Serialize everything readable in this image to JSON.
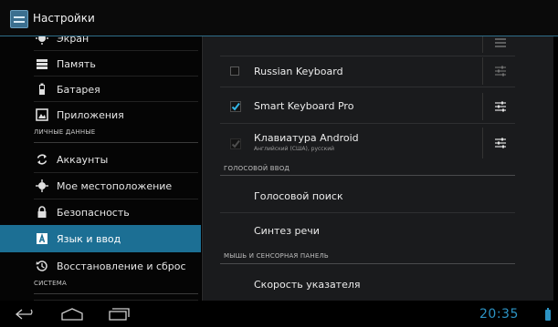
{
  "app": {
    "title": "Настройки"
  },
  "sidebar": {
    "items": [
      {
        "label": "Экран",
        "icon": "display-icon"
      },
      {
        "label": "Память",
        "icon": "storage-icon"
      },
      {
        "label": "Батарея",
        "icon": "battery-icon"
      },
      {
        "label": "Приложения",
        "icon": "apps-icon"
      },
      {
        "label": "Аккаунты",
        "icon": "sync-icon"
      },
      {
        "label": "Мое местоположение",
        "icon": "location-icon"
      },
      {
        "label": "Безопасность",
        "icon": "lock-icon"
      },
      {
        "label": "Язык и ввод",
        "icon": "language-icon",
        "selected": true
      },
      {
        "label": "Восстановление и сброс",
        "icon": "restore-icon"
      }
    ],
    "sections": {
      "personal": "ЛИЧНЫЕ ДАННЫЕ",
      "system": "СИСТЕМА"
    }
  },
  "main": {
    "keyboards": [
      {
        "label": "Russian Keyboard",
        "checked": false
      },
      {
        "label": "Smart Keyboard Pro",
        "checked": true
      },
      {
        "label": "Клавиатура Android",
        "subtitle": "Английский (США), русский",
        "checked": true,
        "disabled": true
      }
    ],
    "voice_section": "ГОЛОСОВОЙ ВВОД",
    "voice_search": "Голосовой поиск",
    "tts": "Синтез речи",
    "pointer_section": "МЫШЬ И СЕНСОРНАЯ ПАНЕЛЬ",
    "pointer_speed": "Скорость указателя"
  },
  "statusbar": {
    "time": "20:35"
  },
  "colors": {
    "accent": "#2c93c4",
    "selected": "#1c6f94",
    "panel": "#1a1b1d"
  }
}
